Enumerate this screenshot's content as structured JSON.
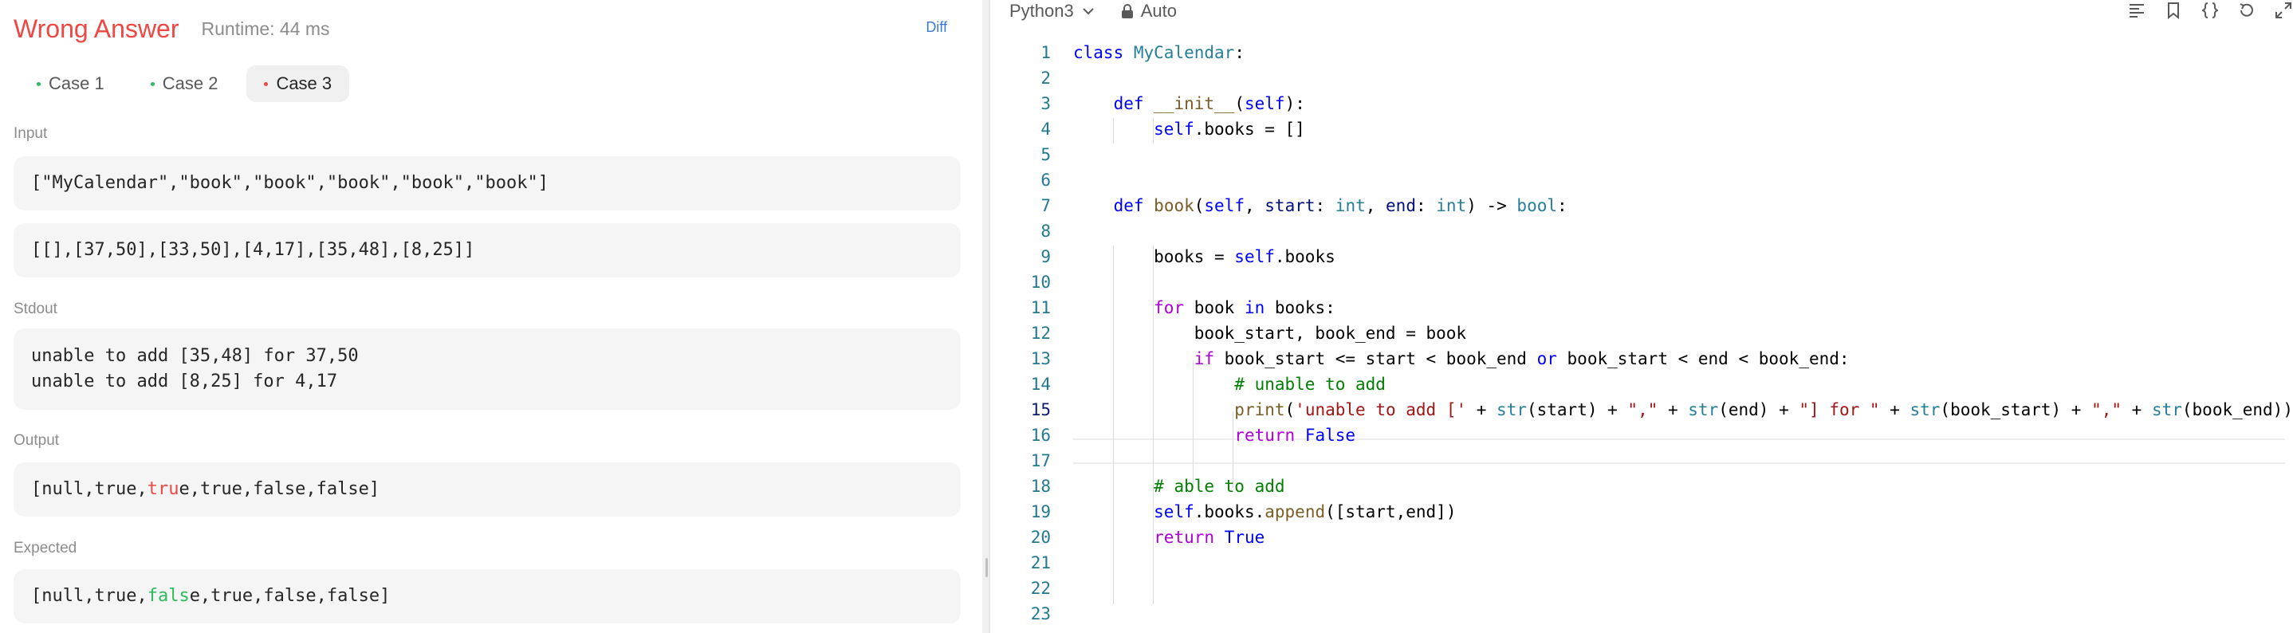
{
  "result": {
    "status": "Wrong Answer",
    "runtime": "Runtime: 44 ms",
    "diff_label": "Diff"
  },
  "tabs": [
    {
      "label": "Case 1",
      "state": "pass"
    },
    {
      "label": "Case 2",
      "state": "pass"
    },
    {
      "label": "Case 3",
      "state": "fail",
      "active": true
    }
  ],
  "input": {
    "label": "Input",
    "line1": "[\"MyCalendar\",\"book\",\"book\",\"book\",\"book\",\"book\"]",
    "line2": "[[],[37,50],[33,50],[4,17],[35,48],[8,25]]"
  },
  "stdout": {
    "label": "Stdout",
    "lines": [
      "unable to add [35,48] for 37,50",
      "unable to add [8,25] for 4,17"
    ]
  },
  "output": {
    "label": "Output",
    "prefix": "[null,true,",
    "diff_part": "tru",
    "suffix": "e,true,false,false]"
  },
  "expected": {
    "label": "Expected",
    "prefix": "[null,true,",
    "diff_part": "fals",
    "suffix": "e,true,false,false]"
  },
  "editor": {
    "language": "Python3",
    "mode": "Auto",
    "current_line": 15,
    "line_numbers": [
      "1",
      "2",
      "3",
      "4",
      "5",
      "6",
      "7",
      "8",
      "9",
      "10",
      "11",
      "12",
      "13",
      "14",
      "15",
      "16",
      "17",
      "18",
      "19",
      "20",
      "21",
      "22",
      "23"
    ]
  },
  "colors": {
    "fail": "#ef4743",
    "pass": "#2cbb5d",
    "accent": "#3a7bd5"
  }
}
